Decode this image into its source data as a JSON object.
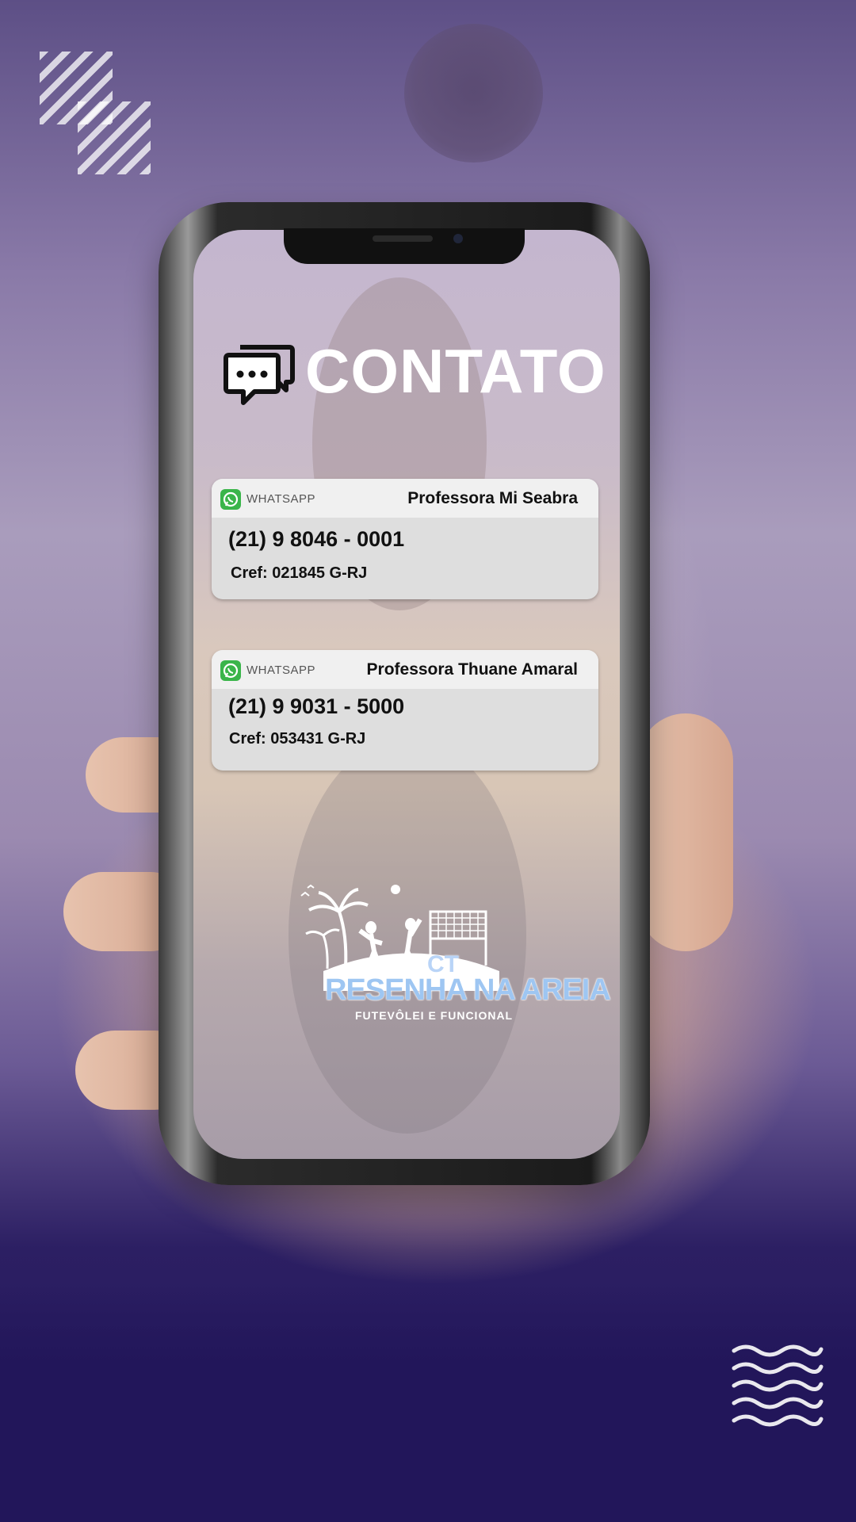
{
  "header": {
    "title": "CONTATO"
  },
  "contacts": [
    {
      "app": "WHATSAPP",
      "name": "Professora Mi Seabra",
      "phone": "(21) 9 8046 - 0001",
      "cref": "Cref: 021845 G-RJ"
    },
    {
      "app": "WHATSAPP",
      "name": "Professora Thuane Amaral",
      "phone": "(21) 9 9031 - 5000",
      "cref": "Cref: 053431 G-RJ"
    }
  ],
  "logo": {
    "ct": "CT",
    "main": "RESENHA NA AREIA",
    "sub": "FUTEVÔLEI E FUNCIONAL"
  },
  "colors": {
    "background_top": "#5d4f86",
    "background_bottom": "#22165a",
    "whatsapp_green": "#3ab54a",
    "card": "#dedede"
  }
}
